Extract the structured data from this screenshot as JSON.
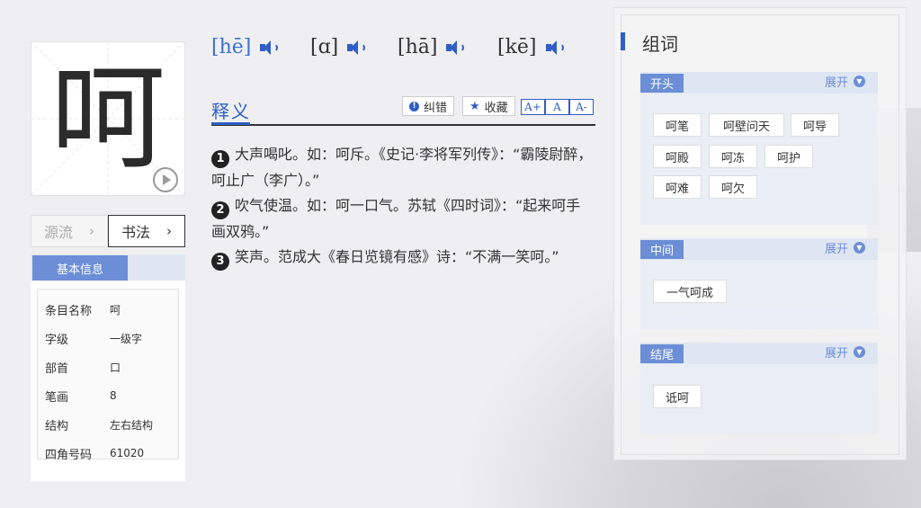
{
  "character": {
    "glyph": "呵",
    "play_icon": "play-circle-icon"
  },
  "tabs": [
    {
      "label": "源流",
      "chevron": "›"
    },
    {
      "label": "书法",
      "chevron": "›"
    }
  ],
  "basic_info": {
    "title": "基本信息",
    "rows": [
      {
        "key": "条目名称",
        "value": "呵"
      },
      {
        "key": "字级",
        "value": "一级字"
      },
      {
        "key": "部首",
        "value": "口"
      },
      {
        "key": "笔画",
        "value": "8"
      },
      {
        "key": "结构",
        "value": "左右结构"
      },
      {
        "key": "四角号码",
        "value": "61020"
      }
    ]
  },
  "pronunciations": [
    "[hē]",
    "[ɑ]",
    "[hā]",
    "[kē]"
  ],
  "definition": {
    "title": "释义",
    "tools": {
      "correct_label": "纠错",
      "collect_label": "收藏",
      "size_up": "A+",
      "size_normal": "A",
      "size_down": "A-"
    },
    "items": [
      {
        "num": "1",
        "text": "大声喝叱。如：呵斥。《史记·李将军列传》：“霸陵尉醉，呵止广（李广）。”"
      },
      {
        "num": "2",
        "text": "吹气使温。如：呵一口气。苏轼《四时词》：“起来呵手画双鸦。”"
      },
      {
        "num": "3",
        "text": "笑声。范成大《春日览镜有感》诗：“不满一笑呵。”"
      }
    ]
  },
  "words": {
    "title": "组词",
    "expand_label": "展开",
    "groups": [
      {
        "label": "开头",
        "items": [
          "呵笔",
          "呵壁问天",
          "呵导",
          "呵殿",
          "呵冻",
          "呵护",
          "呵难",
          "呵欠"
        ]
      },
      {
        "label": "中间",
        "items": [
          "一气呵成"
        ]
      },
      {
        "label": "结尾",
        "items": [
          "诋呵"
        ]
      }
    ]
  },
  "colors": {
    "accent": "#2f5fc4",
    "label_bg": "#6b8ed6",
    "page_bg": "#efeff1"
  }
}
